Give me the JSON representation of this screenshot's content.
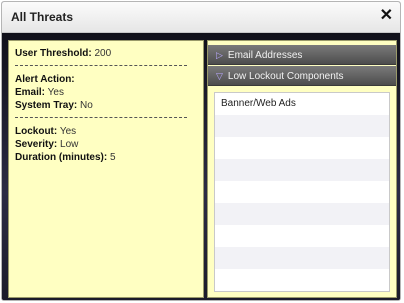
{
  "window": {
    "title": "All Threats",
    "close_glyph": "✕"
  },
  "summary": {
    "user_threshold_label": "User Threshold:",
    "user_threshold_value": "200",
    "alert_action_label": "Alert Action:",
    "email_label": "Email:",
    "email_value": "Yes",
    "system_tray_label": "System Tray:",
    "system_tray_value": "No",
    "lockout_label": "Lockout:",
    "lockout_value": "Yes",
    "severity_label": "Severity:",
    "severity_value": "Low",
    "duration_label": "Duration (minutes):",
    "duration_value": "5"
  },
  "accordion": {
    "sections": [
      {
        "label": "Email Addresses",
        "arrow": "▷",
        "expanded": false
      },
      {
        "label": "Low Lockout Components",
        "arrow": "▽",
        "expanded": true
      }
    ],
    "items": [
      "Banner/Web Ads",
      "",
      "",
      "",
      "",
      "",
      "",
      "",
      ""
    ]
  },
  "colors": {
    "panel_bg": "#ffffc2",
    "header_bg": "#5e5e5e",
    "window_bg": "#1b1b2a"
  }
}
